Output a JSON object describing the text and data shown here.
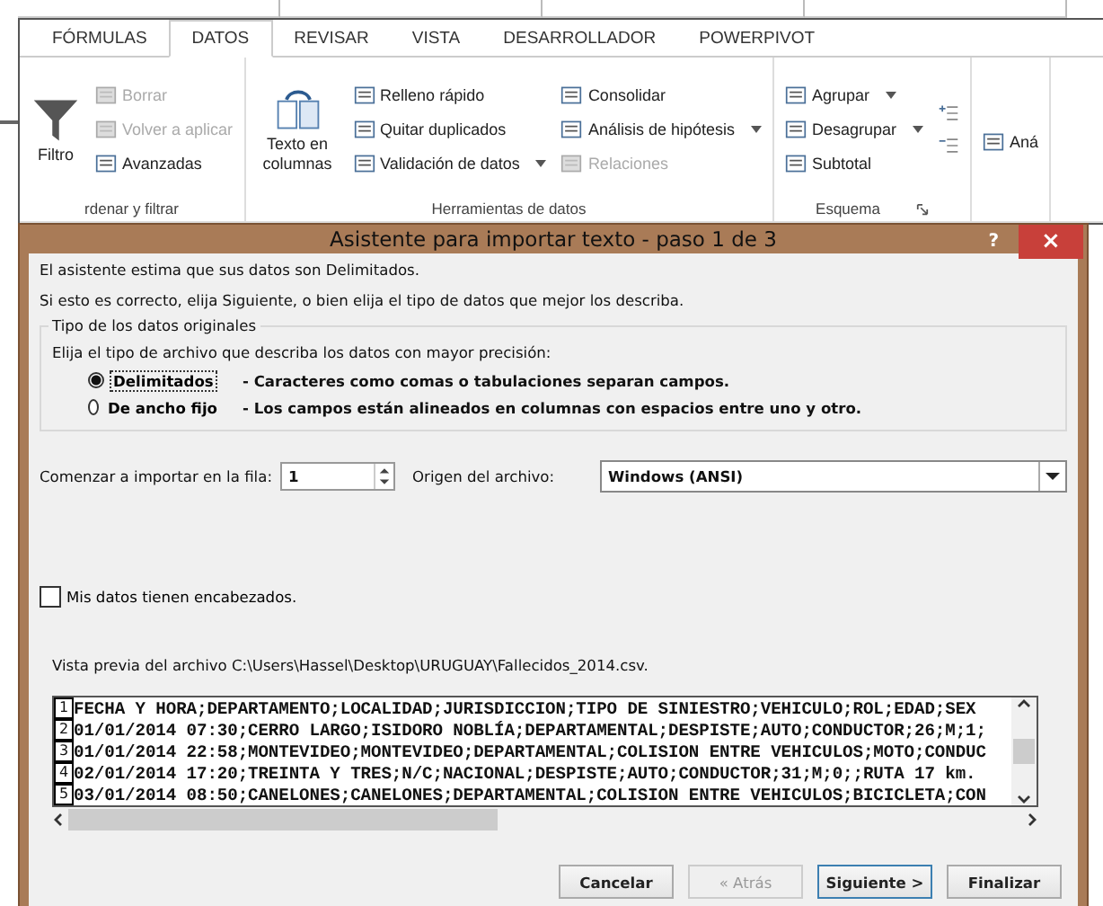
{
  "ribbon": {
    "tabs": [
      {
        "label": "FÓRMULAS",
        "selected": false
      },
      {
        "label": "DATOS",
        "selected": true
      },
      {
        "label": "REVISAR",
        "selected": false
      },
      {
        "label": "VISTA",
        "selected": false
      },
      {
        "label": "DESARROLLADOR",
        "selected": false
      },
      {
        "label": "POWERPIVOT",
        "selected": false
      }
    ],
    "groups": [
      {
        "label": "rdenar y filtrar",
        "columns": [
          [
            {
              "kind": "large",
              "label": "Filtro",
              "disabled": false
            }
          ],
          [
            {
              "kind": "small",
              "label": "Borrar",
              "disabled": true
            },
            {
              "kind": "small",
              "label": "Volver a aplicar",
              "disabled": true
            },
            {
              "kind": "small",
              "label": "Avanzadas",
              "disabled": false
            }
          ]
        ]
      },
      {
        "label": "Herramientas de datos",
        "columns": [
          [
            {
              "kind": "large",
              "label": "Texto en columnas",
              "disabled": false
            }
          ],
          [
            {
              "kind": "small",
              "label": "Relleno rápido",
              "disabled": false
            },
            {
              "kind": "small",
              "label": "Quitar duplicados",
              "disabled": false
            },
            {
              "kind": "small",
              "label": "Validación de datos",
              "disabled": false,
              "dropdown": true
            }
          ],
          [
            {
              "kind": "small",
              "label": "Consolidar",
              "disabled": false
            },
            {
              "kind": "small",
              "label": "Análisis de hipótesis",
              "disabled": false,
              "dropdown": true
            },
            {
              "kind": "small",
              "label": "Relaciones",
              "disabled": true
            }
          ]
        ]
      },
      {
        "label": "Esquema",
        "launcher": true,
        "columns": [
          [
            {
              "kind": "small",
              "label": "Agrupar",
              "disabled": false,
              "dropdown": true
            },
            {
              "kind": "small",
              "label": "Desagrupar",
              "disabled": false,
              "dropdown": true
            },
            {
              "kind": "small",
              "label": "Subtotal",
              "disabled": false
            }
          ],
          [
            {
              "kind": "icon",
              "disabled": false
            },
            {
              "kind": "icon",
              "disabled": false
            }
          ]
        ]
      },
      {
        "columns": [
          [
            {
              "kind": "small",
              "label": "Aná",
              "disabled": false
            }
          ]
        ]
      }
    ]
  },
  "dialog": {
    "title": "Asistente para importar texto - paso 1 de 3",
    "help": "?",
    "close": "×",
    "intro": [
      "El asistente estima que sus datos son Delimitados.",
      "Si esto es correcto, elija Siguiente, o bien elija el tipo de datos que mejor los describa."
    ],
    "group": {
      "legend": "Tipo de los datos originales",
      "prompt": "Elija el tipo de archivo que describa los datos con mayor precisión:",
      "options": [
        {
          "label": "Delimitados",
          "description": "- Caracteres como comas o tabulaciones separan campos.",
          "selected": true
        },
        {
          "label": "De ancho fijo",
          "description": "- Los campos están alineados en columnas con espacios entre uno y otro.",
          "selected": false
        }
      ]
    },
    "start_row": {
      "label": "Comenzar a importar en la fila:",
      "value": "1"
    },
    "origin": {
      "label": "Origen del archivo:",
      "value": "Windows (ANSI)"
    },
    "headers": {
      "label": "Mis datos tienen encabezados.",
      "checked": false
    },
    "preview": {
      "label": "Vista previa del archivo C:\\Users\\Hassel\\Desktop\\URUGUAY\\Fallecidos_2014.csv.",
      "rows": [
        {
          "number": "1",
          "text": "FECHA Y HORA;DEPARTAMENTO;LOCALIDAD;JURISDICCION;TIPO DE SINIESTRO;VEHICULO;ROL;EDAD;SEX"
        },
        {
          "number": "2",
          "text": "01/01/2014 07:30;CERRO LARGO;ISIDORO NOBLÍA;DEPARTAMENTAL;DESPISTE;AUTO;CONDUCTOR;26;M;1;"
        },
        {
          "number": "3",
          "text": "01/01/2014 22:58;MONTEVIDEO;MONTEVIDEO;DEPARTAMENTAL;COLISION ENTRE VEHICULOS;MOTO;CONDUC"
        },
        {
          "number": "4",
          "text": "02/01/2014 17:20;TREINTA Y TRES;N/C;NACIONAL;DESPISTE;AUTO;CONDUCTOR;31;M;0;;RUTA 17 km."
        },
        {
          "number": "5",
          "text": "03/01/2014 08:50;CANELONES;CANELONES;DEPARTAMENTAL;COLISION ENTRE VEHICULOS;BICICLETA;CON"
        }
      ]
    },
    "buttons": [
      {
        "label": "Cancelar",
        "disabled": false,
        "default": false
      },
      {
        "label": "« Atrás",
        "disabled": true,
        "default": false
      },
      {
        "label": "Siguiente >",
        "disabled": false,
        "default": true
      },
      {
        "label": "Finalizar",
        "disabled": false,
        "default": false
      }
    ]
  }
}
